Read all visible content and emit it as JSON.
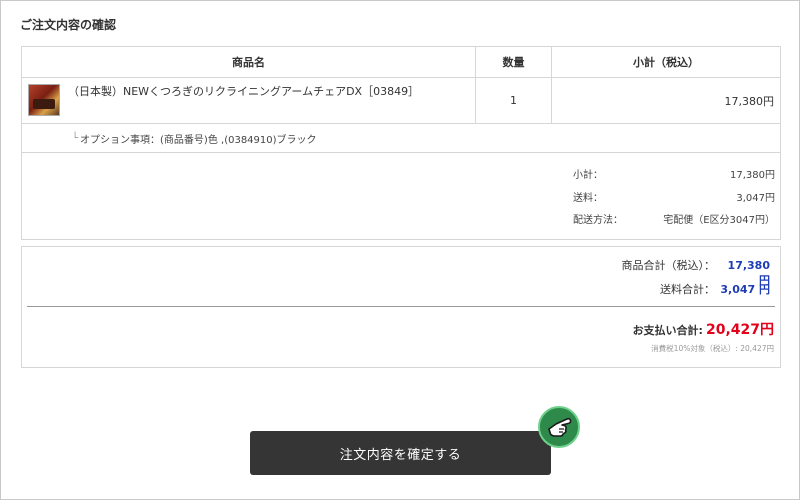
{
  "page": {
    "title": "ご注文内容の確認"
  },
  "table": {
    "headers": {
      "product": "商品名",
      "quantity": "数量",
      "subtotal": "小計（税込）"
    },
    "item": {
      "name": "（日本製）NEWくつろぎのリクライニングアームチェアDX［03849］",
      "quantity": "1",
      "subtotal": "17,380円",
      "option_tree": "└",
      "option": "オプション事項：(商品番号)色 ,(0384910)ブラック"
    },
    "summary": {
      "subtotal_label": "小計：",
      "subtotal_value": "17,380円",
      "shipping_label": "送料：",
      "shipping_value": "3,047円",
      "delivery_label": "配送方法：",
      "delivery_value": "宅配便（E区分3047円）"
    }
  },
  "totals": {
    "products_label": "商品合計（税込）：",
    "products_value": "17,380 円",
    "shipping_label": "送料合計：",
    "shipping_value": "3,047 円",
    "payment_label": "お支払い合計:",
    "payment_value": "20,427円",
    "tax_note": "消費税10%対象（税込）: 20,427円"
  },
  "actions": {
    "confirm_label": "注文内容を確定する"
  },
  "icons": {
    "pointer": "pointing-hand-icon"
  },
  "colors": {
    "accent_blue": "#1e3cb4",
    "accent_red": "#e2001a",
    "button_bg": "#353535",
    "icon_green": "#2d8a4a"
  }
}
